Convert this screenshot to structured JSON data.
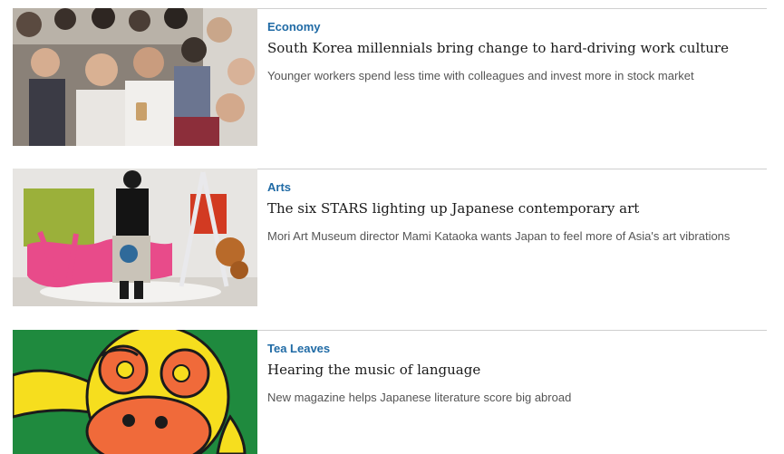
{
  "articles": [
    {
      "category": "Economy",
      "headline": "South Korea millennials bring change to hard-driving work culture",
      "summary": "Younger workers spend less time with colleagues and invest more in stock market",
      "image": "crowd-selfie-photo"
    },
    {
      "category": "Arts",
      "headline": "The six STARS lighting up Japanese contemporary art",
      "summary": "Mori Art Museum director Mami Kataoka wants Japan to feel more of Asia's art vibrations",
      "image": "gallery-portrait-photo"
    },
    {
      "category": "Tea Leaves",
      "headline": "Hearing the music of language",
      "summary": "New magazine helps Japanese literature score big abroad",
      "image": "monkey-illustration"
    }
  ],
  "colors": {
    "category": "#1f6aa5",
    "headline": "#1a1a1a",
    "summary": "#555555",
    "divider": "#cfcfcf"
  }
}
